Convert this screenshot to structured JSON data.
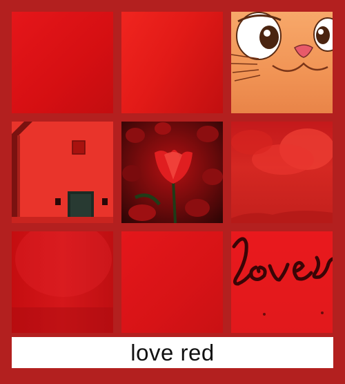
{
  "caption": {
    "text": "love red"
  },
  "tiles": [
    {
      "name": "red-gradient-square-1"
    },
    {
      "name": "red-gradient-square-2"
    },
    {
      "name": "cartoon-cat-face"
    },
    {
      "name": "red-house-wall"
    },
    {
      "name": "red-tulip-field"
    },
    {
      "name": "red-sky-clouds"
    },
    {
      "name": "red-glossy-surface"
    },
    {
      "name": "red-gradient-square-3"
    },
    {
      "name": "love-script-card",
      "text": "love"
    }
  ],
  "colors": {
    "frame": "#b3201f",
    "caption_bg": "#ffffff",
    "caption_text": "#111111"
  }
}
